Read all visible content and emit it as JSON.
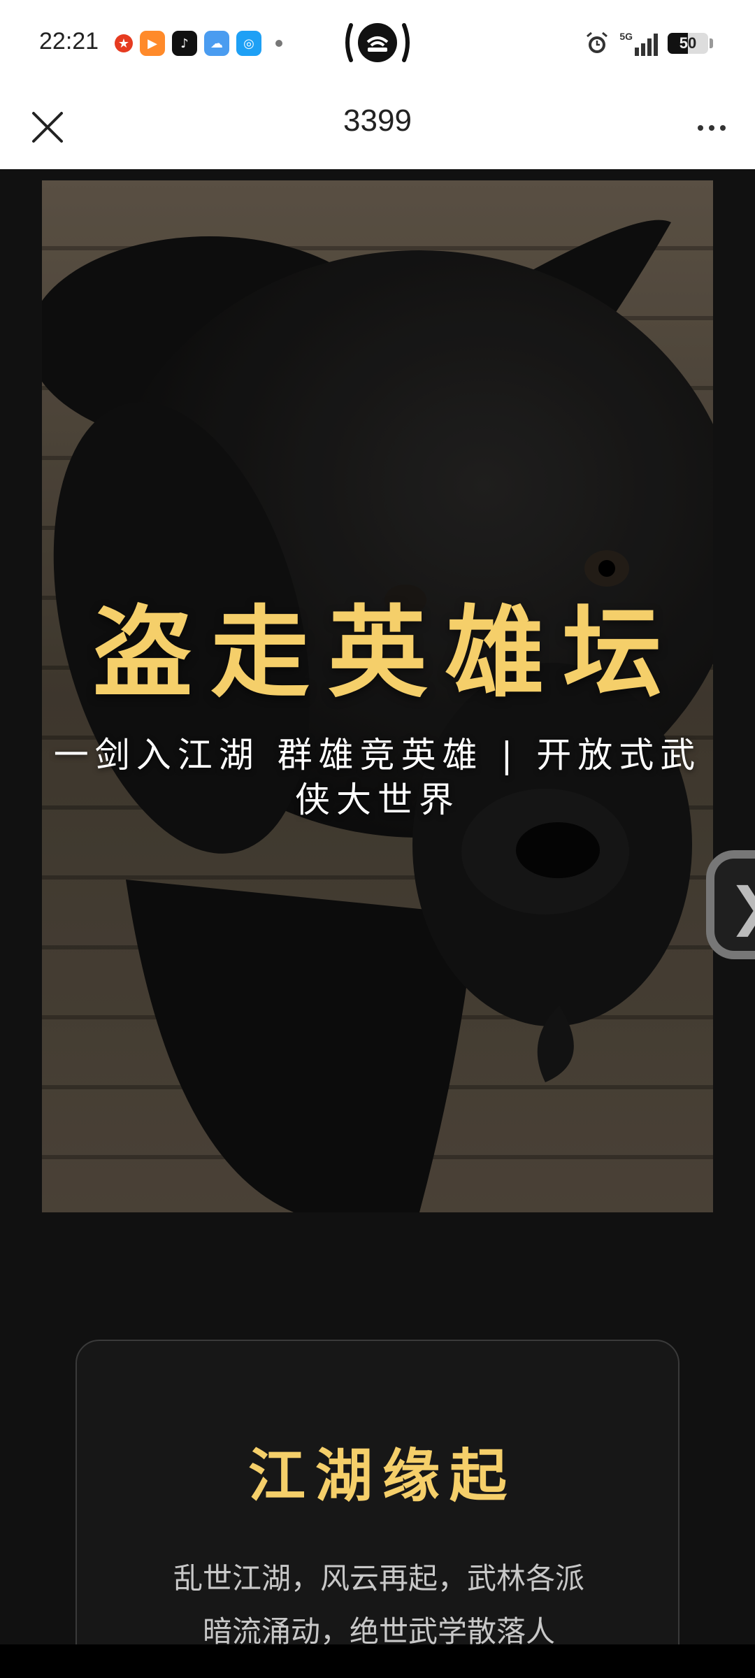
{
  "status_bar": {
    "time": "22:21",
    "network": "5G",
    "battery": "50",
    "notification_icons": [
      "offer-app-icon",
      "video-player-icon",
      "tiktok-icon",
      "weather-icon",
      "browser-icon"
    ]
  },
  "nav": {
    "title": "3399"
  },
  "hero": {
    "title": "盗走英雄坛",
    "subtitle": "一剑入江湖 群雄竞英雄 | 开放式武侠大世界"
  },
  "story": {
    "title": "江湖缘起",
    "text": "乱世江湖，风云再起，武林各派暗流涌动，绝世武学散落人"
  },
  "colors": {
    "accent": "#f5cf6a",
    "page_background": "#111111",
    "card_background": "#171717"
  }
}
